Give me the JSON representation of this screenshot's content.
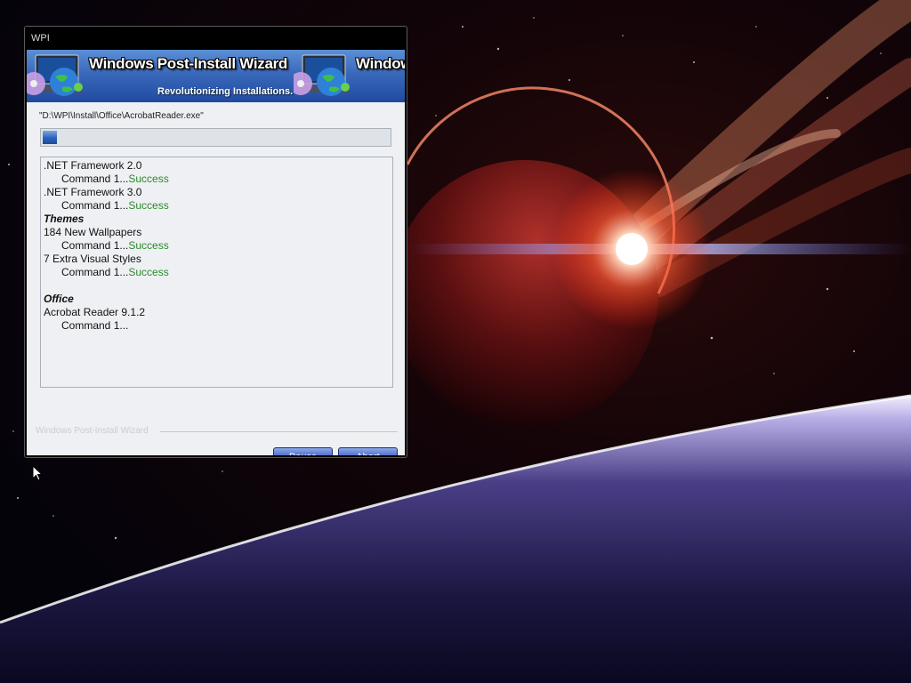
{
  "window": {
    "title": "WPI"
  },
  "banner": {
    "title": "Windows Post-Install Wizard",
    "title_partial": "Window",
    "subtitle": "Revolutionizing Installations."
  },
  "install": {
    "current_path": "\"D:\\WPI\\Install\\Office\\AcrobatReader.exe\"",
    "progress": 0.04
  },
  "log": [
    {
      "kind": "item",
      "text": ".NET Framework 2.0"
    },
    {
      "kind": "command",
      "text": "Command 1...",
      "status": "Success"
    },
    {
      "kind": "item",
      "text": ".NET Framework 3.0"
    },
    {
      "kind": "command",
      "text": "Command 1...",
      "status": "Success"
    },
    {
      "kind": "category",
      "text": "Themes"
    },
    {
      "kind": "item",
      "text": "184 New Wallpapers"
    },
    {
      "kind": "command",
      "text": "Command 1...",
      "status": "Success"
    },
    {
      "kind": "item",
      "text": "7 Extra Visual Styles"
    },
    {
      "kind": "command",
      "text": "Command 1...",
      "status": "Success"
    },
    {
      "kind": "blank",
      "text": ""
    },
    {
      "kind": "category",
      "text": "Office"
    },
    {
      "kind": "item",
      "text": "Acrobat Reader 9.1.2"
    },
    {
      "kind": "command",
      "text": "Command 1...",
      "status": ""
    }
  ],
  "footer": {
    "brand": "Windows Post-Install Wizard"
  },
  "buttons": {
    "pause": "Pause",
    "abort": "Abort"
  },
  "colors": {
    "success": "#2a8a2a",
    "banner_blue": "#3a69bb",
    "button_blue": "#3d61c6"
  },
  "icons": {
    "banner_logo": "globe-laptop-icon",
    "cursor": "mouse-pointer-icon"
  }
}
